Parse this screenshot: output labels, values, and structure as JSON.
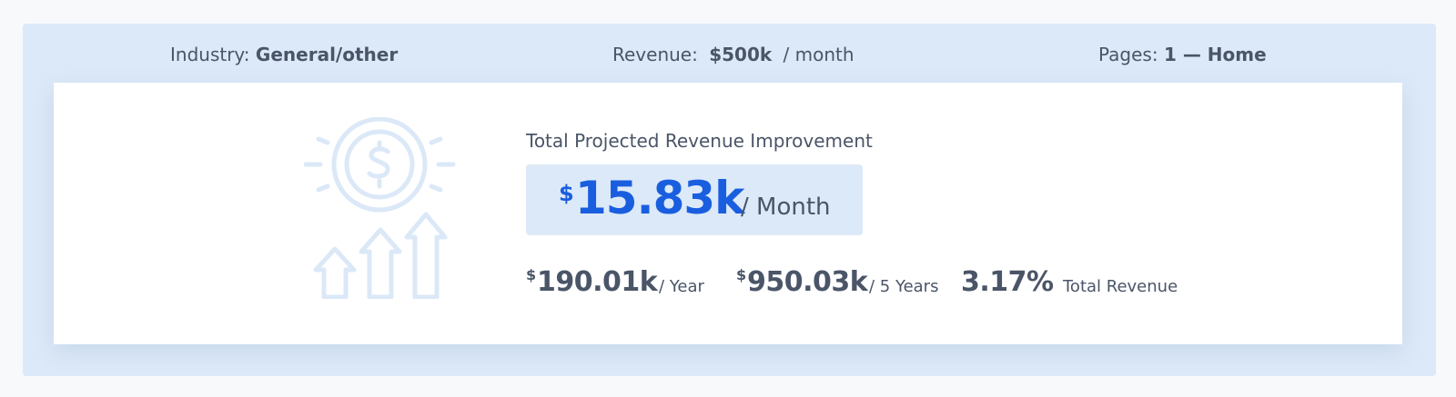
{
  "header": {
    "industry_label": "Industry:",
    "industry_value": "General/other",
    "revenue_label": "Revenue:",
    "revenue_value": "$500k",
    "revenue_unit": "/ month",
    "pages_label": "Pages:",
    "pages_value": "1 — Home"
  },
  "summary": {
    "title": "Total Projected Revenue Improvement",
    "monthly": {
      "currency": "$",
      "value": "15.83k",
      "unit": "/ Month"
    },
    "yearly": {
      "currency": "$",
      "value": "190.01k",
      "unit": "/ Year"
    },
    "five_year": {
      "currency": "$",
      "value": "950.03k",
      "unit": "/ 5 Years"
    },
    "percent": {
      "value": "3.17%",
      "unit": "Total Revenue"
    }
  },
  "illustration": {
    "icon": "revenue-growth-icon",
    "color": "#dbe8f7"
  },
  "colors": {
    "accent": "#1a5ee0",
    "panel": "#dce9f8",
    "text": "#4a5568"
  }
}
